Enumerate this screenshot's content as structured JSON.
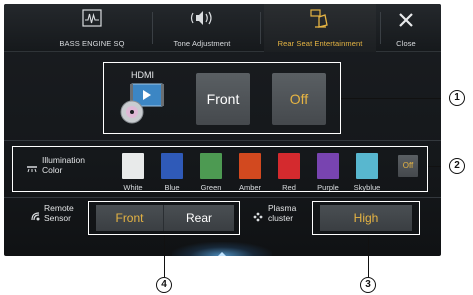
{
  "tabs": [
    {
      "label": "BASS ENGINE SQ",
      "icon": "waveform-icon"
    },
    {
      "label": "Tone Adjustment",
      "icon": "speaker-icon"
    },
    {
      "label": "Rear Seat Entertainment",
      "icon": "rear-seat-icon",
      "active": true
    },
    {
      "label": "Close",
      "icon": "close-icon"
    }
  ],
  "source": {
    "label": "HDMI",
    "front_label": "Front",
    "off_label": "Off"
  },
  "illumination": {
    "label_line1": "Illumination",
    "label_line2": "Color",
    "colors": [
      {
        "name": "White",
        "hex": "#e8eaea"
      },
      {
        "name": "Blue",
        "hex": "#2f5ab8"
      },
      {
        "name": "Green",
        "hex": "#4d9a52"
      },
      {
        "name": "Amber",
        "hex": "#d2491f"
      },
      {
        "name": "Red",
        "hex": "#d42a2e"
      },
      {
        "name": "Purple",
        "hex": "#7844b0"
      },
      {
        "name": "Skyblue",
        "hex": "#58b7cf"
      }
    ],
    "off_label": "Off"
  },
  "remote_sensor": {
    "label_line1": "Remote",
    "label_line2": "Sensor",
    "front_label": "Front",
    "rear_label": "Rear"
  },
  "plasma_cluster": {
    "label_line1": "Plasma",
    "label_line2": "cluster",
    "value": "High"
  },
  "callouts": [
    "1",
    "2",
    "3",
    "4"
  ],
  "colors": {
    "accent": "#e6b443",
    "text": "#d9dcdf",
    "button": "#4f5458"
  }
}
